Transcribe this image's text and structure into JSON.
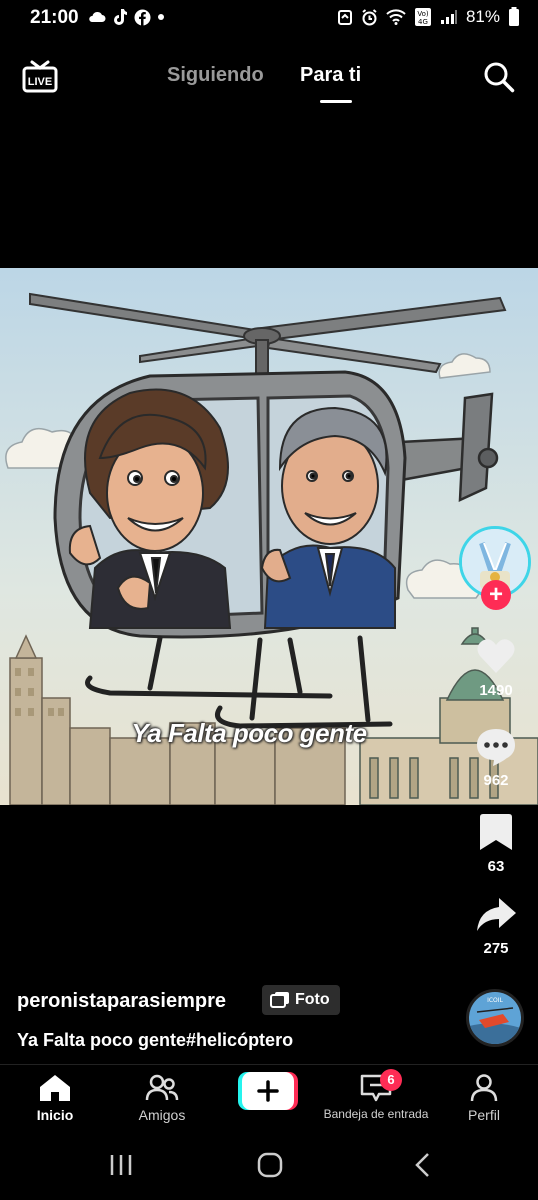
{
  "status_bar": {
    "time": "21:00",
    "battery": "81%",
    "network": "Vo) 4G"
  },
  "top_nav": {
    "live_label": "LIVE",
    "tabs": [
      "Siguiendo",
      "Para ti"
    ]
  },
  "post": {
    "overlay_text": "Ya Falta poco gente",
    "username": "peronistaparasiempre",
    "type_badge": "Foto",
    "description": "Ya Falta poco gente#helicóptero",
    "likes": "1490",
    "comments": "962",
    "saves": "63",
    "shares": "275"
  },
  "bottom_nav": {
    "items": [
      "Inicio",
      "Amigos",
      "Bandeja de entrada",
      "Perfil"
    ],
    "inbox_badge": "6"
  },
  "colors": {
    "accent": "#fe2c55",
    "cyan": "#25f4ee",
    "background": "#000000"
  }
}
